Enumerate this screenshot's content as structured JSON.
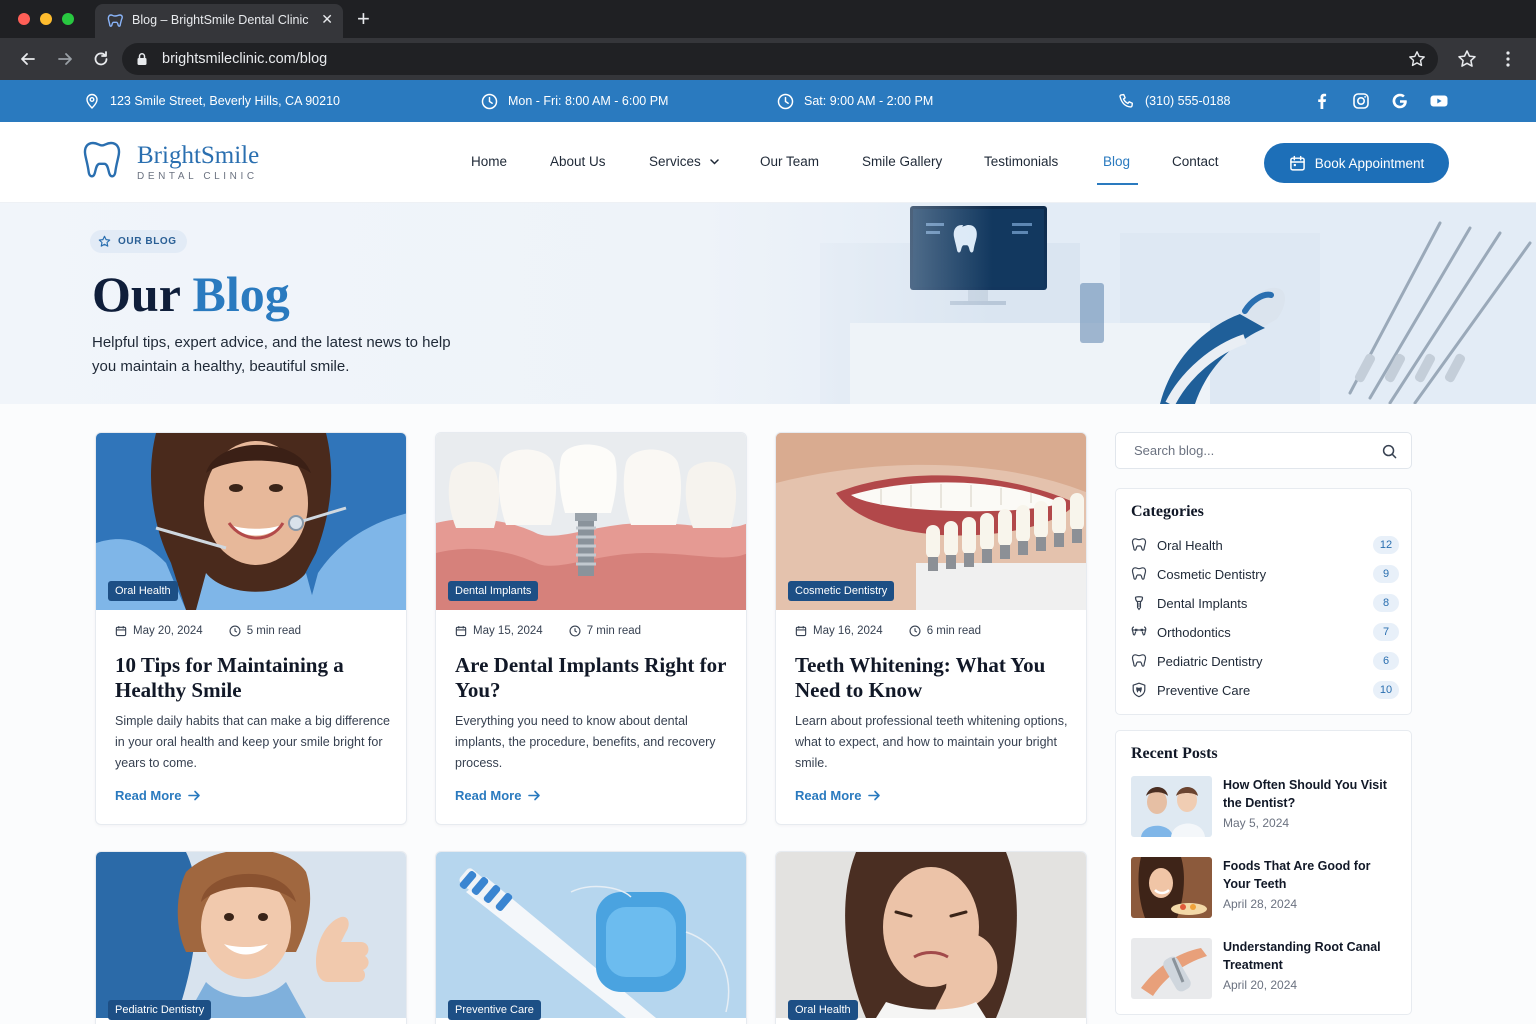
{
  "browser": {
    "tab_title": "Blog – BrightSmile Dental Clinic",
    "url": "brightsmileclinic.com/blog"
  },
  "infobar": {
    "address": "123 Smile Street, Beverly Hills, CA 90210",
    "weekday_hours": "Mon - Fri: 8:00 AM - 6:00 PM",
    "saturday_hours": "Sat: 9:00 AM - 2:00 PM",
    "phone": "(310) 555-0188",
    "social": [
      "facebook-icon",
      "instagram-icon",
      "google-icon",
      "youtube-icon"
    ]
  },
  "logo": {
    "name": "BrightSmile",
    "tagline": "DENTAL CLINIC"
  },
  "nav": {
    "items": [
      "Home",
      "About Us",
      "Services",
      "Our Team",
      "Smile Gallery",
      "Testimonials",
      "Blog",
      "Contact"
    ],
    "active": "Blog",
    "cta": "Book Appointment"
  },
  "hero": {
    "badge": "OUR BLOG",
    "title_main": "Our",
    "title_accent": "Blog",
    "subtitle": "Helpful tips, expert advice, and the latest news to help you maintain a healthy, beautiful smile."
  },
  "posts": [
    {
      "tag": "Oral Health",
      "date": "May 20, 2024",
      "read_time": "5 min read",
      "title": "10 Tips for Maintaining a Healthy Smile",
      "excerpt": "Simple daily habits that can make a big difference in your oral health and keep your smile bright for years to come.",
      "cta": "Read More"
    },
    {
      "tag": "Dental Implants",
      "date": "May 15, 2024",
      "read_time": "7 min read",
      "title": "Are Dental Implants Right for You?",
      "excerpt": "Everything you need to know about dental implants, the procedure, benefits, and recovery process.",
      "cta": "Read More"
    },
    {
      "tag": "Cosmetic Dentistry",
      "date": "May 16, 2024",
      "read_time": "6 min read",
      "title": "Teeth Whitening: What You Need to Know",
      "excerpt": "Learn about professional teeth whitening options, what to expect, and how to maintain your bright smile.",
      "cta": "Read More"
    },
    {
      "tag": "Pediatric Dentistry"
    },
    {
      "tag": "Preventive Care"
    },
    {
      "tag": "Oral Health"
    }
  ],
  "sidebar": {
    "search_placeholder": "Search blog...",
    "categories_title": "Categories",
    "categories": [
      {
        "label": "Oral Health",
        "count": "12",
        "icon": "tooth-icon"
      },
      {
        "label": "Cosmetic Dentistry",
        "count": "9",
        "icon": "tooth-icon"
      },
      {
        "label": "Dental Implants",
        "count": "8",
        "icon": "implant-icon"
      },
      {
        "label": "Orthodontics",
        "count": "7",
        "icon": "braces-icon"
      },
      {
        "label": "Pediatric Dentistry",
        "count": "6",
        "icon": "tooth-icon"
      },
      {
        "label": "Preventive Care",
        "count": "10",
        "icon": "shield-tooth-icon"
      }
    ],
    "recent_title": "Recent Posts",
    "recent": [
      {
        "title": "How Often Should You Visit the Dentist?",
        "date": "May 5, 2024"
      },
      {
        "title": "Foods That Are Good for Your Teeth",
        "date": "April 28, 2024"
      },
      {
        "title": "Understanding Root Canal Treatment",
        "date": "April 20, 2024"
      }
    ]
  },
  "colors": {
    "brand": "#2a7abf",
    "button": "#1d6fb8",
    "heading": "#0f1e3a",
    "tag_bg": "#1d4f85"
  }
}
